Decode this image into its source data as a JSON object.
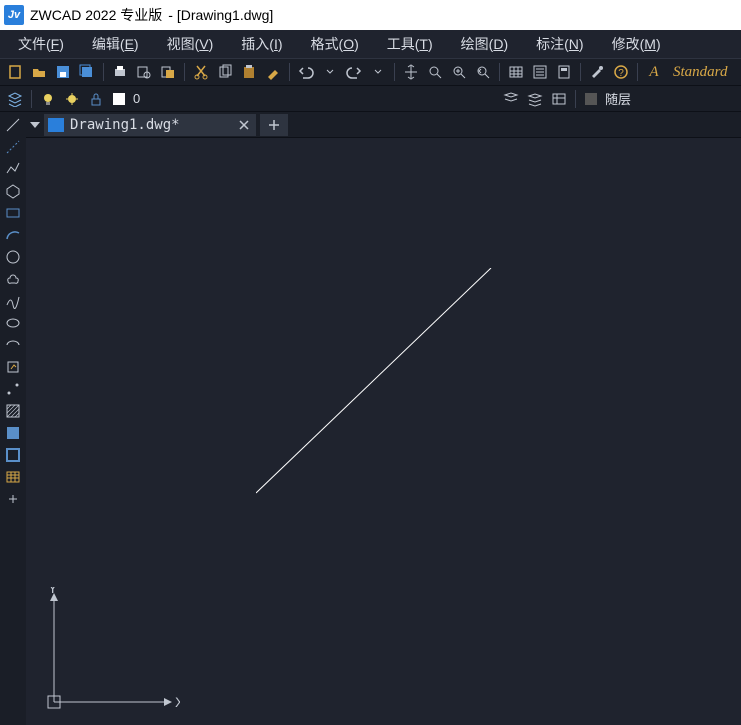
{
  "title": {
    "app": "ZWCAD 2022 专业版",
    "doc": "[Drawing1.dwg]"
  },
  "menu": {
    "file": "文件(",
    "fileK": "F",
    "fileE": ")",
    "edit": "编辑(",
    "editK": "E",
    "editE": ")",
    "view": "视图(",
    "viewK": "V",
    "viewE": ")",
    "insert": "插入(",
    "insertK": "I",
    "insertE": ")",
    "format": "格式(",
    "formatK": "O",
    "formatE": ")",
    "tools": "工具(",
    "toolsK": "T",
    "toolsE": ")",
    "draw": "绘图(",
    "drawK": "D",
    "drawE": ")",
    "dim": "标注(",
    "dimK": "N",
    "dimE": ")",
    "modify": "修改(",
    "modifyK": "M",
    "modifyE": ")"
  },
  "toolbar": {
    "style": "Standard"
  },
  "layer": {
    "current": "0",
    "bylayer": "随层"
  },
  "layer_icons": [
    "layers",
    "bulb",
    "sun",
    "lock",
    "square"
  ],
  "tab": {
    "name": "Drawing1.dwg*"
  },
  "std_icons": [
    "new",
    "open",
    "save",
    "saveall",
    "sep",
    "print",
    "preview",
    "pdf",
    "sep",
    "cut",
    "copy",
    "paste",
    "brush",
    "sep",
    "undo",
    "redo",
    "sep",
    "pan",
    "zoomwin",
    "zoomext",
    "zoomprev",
    "sep",
    "table",
    "props",
    "calc",
    "sep",
    "wrench",
    "help"
  ],
  "right_icons": [
    "list1",
    "list2",
    "layers3",
    "sep",
    "swatch"
  ],
  "ucs": {
    "x": "X",
    "y": "Y"
  }
}
